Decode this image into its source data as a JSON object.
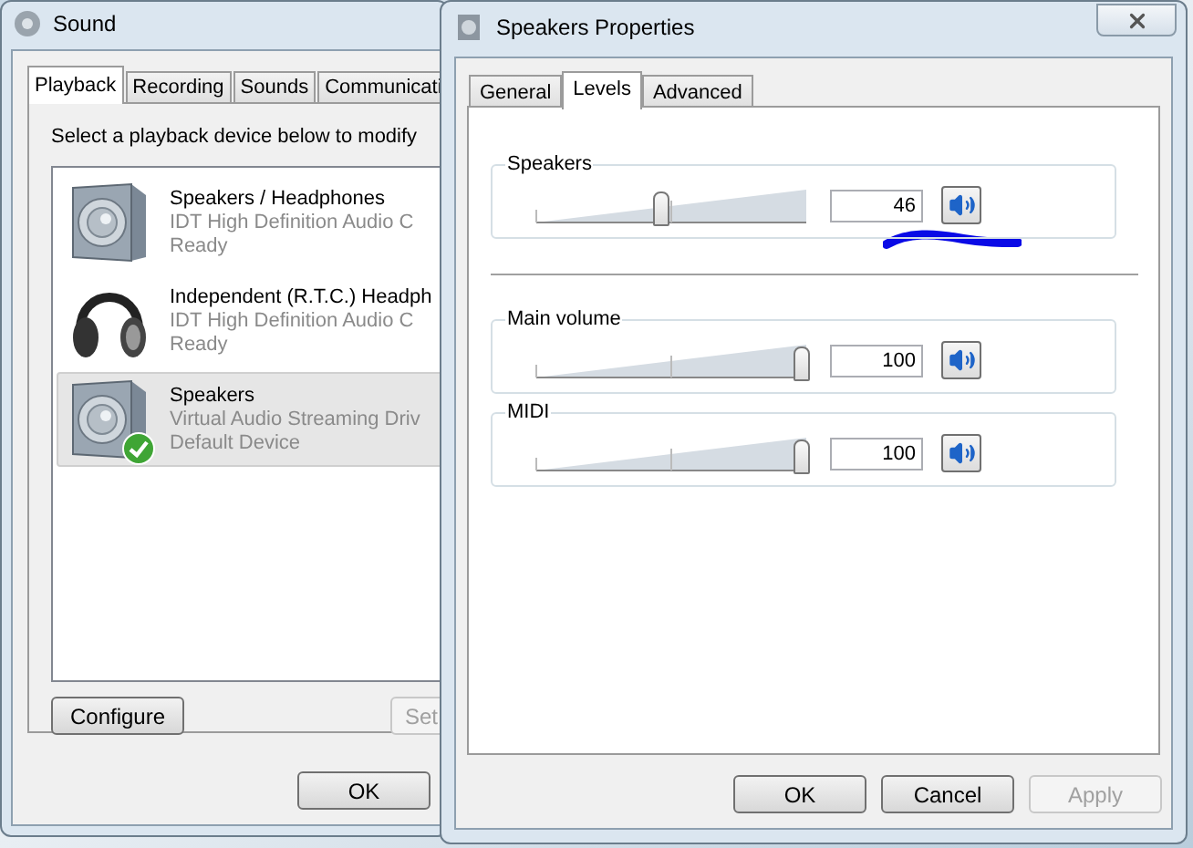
{
  "sound_window": {
    "title": "Sound",
    "tabs": [
      {
        "label": "Playback",
        "selected": true
      },
      {
        "label": "Recording",
        "selected": false
      },
      {
        "label": "Sounds",
        "selected": false
      },
      {
        "label": "Communicati",
        "selected": false
      }
    ],
    "instruction": "Select a playback device below to modify",
    "devices": [
      {
        "kind": "speaker",
        "name": "Speakers / Headphones",
        "driver": "IDT High Definition Audio C",
        "status": "Ready",
        "default": false,
        "selected": false
      },
      {
        "kind": "headphones",
        "name": "Independent (R.T.C.) Headph",
        "driver": "IDT High Definition Audio C",
        "status": "Ready",
        "default": false,
        "selected": false
      },
      {
        "kind": "speaker",
        "name": "Speakers",
        "driver": "Virtual Audio Streaming Driv",
        "status": "Default Device",
        "default": true,
        "selected": true
      }
    ],
    "buttons": [
      {
        "label": "Configure",
        "disabled": false
      },
      {
        "label": "Set",
        "disabled": true
      }
    ],
    "footer_buttons": [
      {
        "label": "OK",
        "disabled": false
      }
    ]
  },
  "properties_window": {
    "title": "Speakers Properties",
    "tabs": [
      {
        "label": "General",
        "selected": false
      },
      {
        "label": "Levels",
        "selected": true
      },
      {
        "label": "Advanced",
        "selected": false
      }
    ],
    "master": {
      "label": "Speakers",
      "level": 0.46,
      "value": "46",
      "muted": false
    },
    "channels": [
      {
        "label": "Main volume",
        "level": 1,
        "value": "100",
        "muted": false
      },
      {
        "label": "MIDI",
        "level": 1,
        "value": "100",
        "muted": false
      }
    ],
    "footer_buttons": [
      {
        "label": "OK",
        "disabled": false
      },
      {
        "label": "Cancel",
        "disabled": false
      },
      {
        "label": "Apply",
        "disabled": true
      }
    ]
  }
}
